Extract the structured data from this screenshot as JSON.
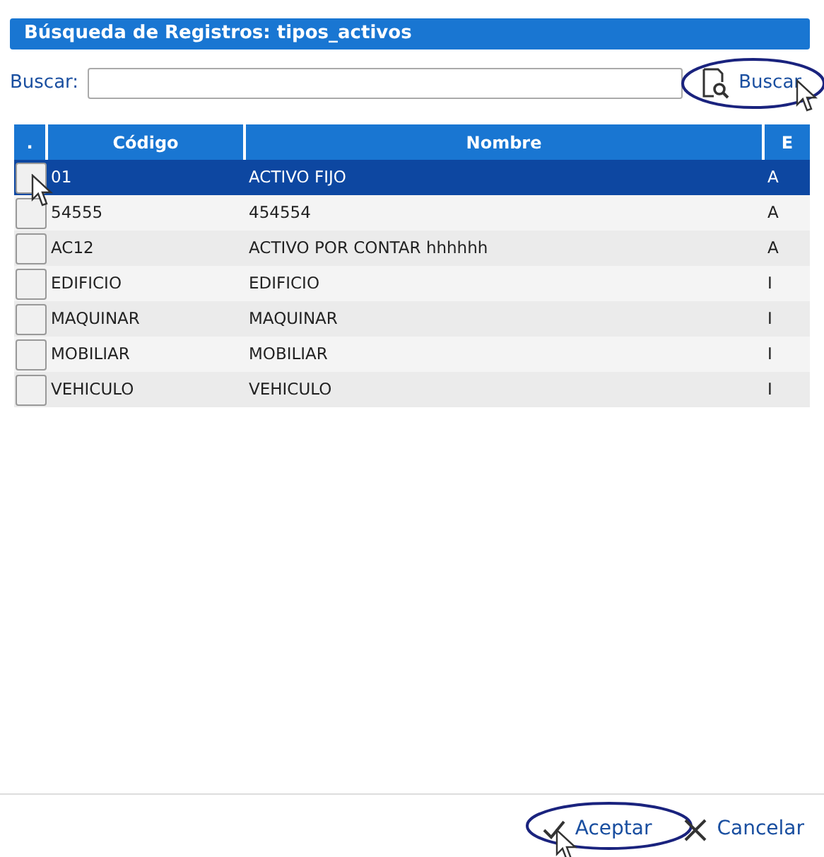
{
  "dialog": {
    "title": "Búsqueda de Registros: tipos_activos"
  },
  "search": {
    "label": "Buscar:",
    "button": "Buscar"
  },
  "table": {
    "columns": [
      ".",
      "Código",
      "Nombre",
      "E"
    ],
    "rows": [
      {
        "selected": true,
        "codigo": "01",
        "nombre": "ACTIVO FIJO",
        "estado": "A"
      },
      {
        "selected": false,
        "codigo": "54555",
        "nombre": "454554",
        "estado": "A"
      },
      {
        "selected": false,
        "codigo": "AC12",
        "nombre": "ACTIVO POR CONTAR hhhhhh",
        "estado": "A"
      },
      {
        "selected": false,
        "codigo": "EDIFICIO",
        "nombre": "EDIFICIO",
        "estado": "I"
      },
      {
        "selected": false,
        "codigo": "MAQUINAR",
        "nombre": "MAQUINAR",
        "estado": "I"
      },
      {
        "selected": false,
        "codigo": "MOBILIAR",
        "nombre": "MOBILIAR",
        "estado": "I"
      },
      {
        "selected": false,
        "codigo": "VEHICULO",
        "nombre": "VEHICULO",
        "estado": "I"
      }
    ]
  },
  "footer": {
    "buttons": [
      {
        "kind": "accept",
        "label": "Aceptar"
      },
      {
        "kind": "cancel",
        "label": "Cancelar"
      }
    ]
  }
}
